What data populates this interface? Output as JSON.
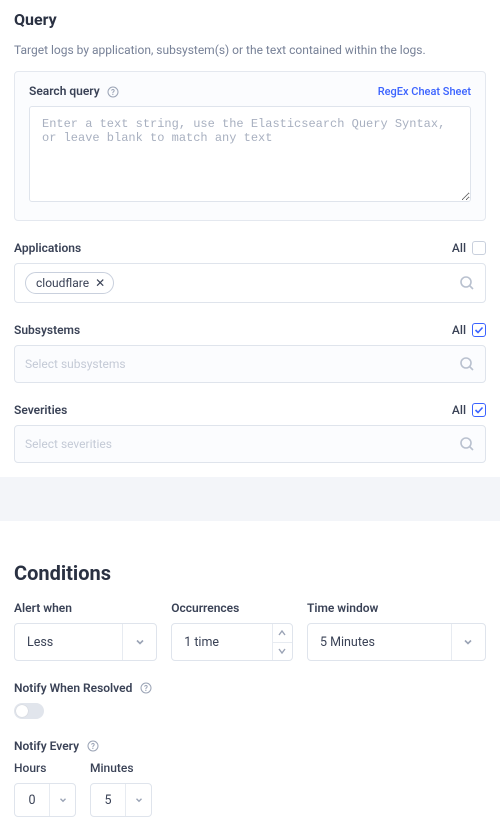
{
  "query": {
    "title": "Query",
    "subtitle": "Target logs by application, subsystem(s) or the text contained within the logs.",
    "search_label": "Search query",
    "cheat_link": "RegEx Cheat Sheet",
    "search_placeholder": "Enter a text string, use the Elasticsearch Query Syntax, or leave blank to match any text",
    "applications": {
      "label": "Applications",
      "all_label": "All",
      "all_checked": false,
      "chips": [
        "cloudflare"
      ]
    },
    "subsystems": {
      "label": "Subsystems",
      "all_label": "All",
      "all_checked": true,
      "placeholder": "Select subsystems"
    },
    "severities": {
      "label": "Severities",
      "all_label": "All",
      "all_checked": true,
      "placeholder": "Select severities"
    }
  },
  "conditions": {
    "title": "Conditions",
    "alert_when_label": "Alert when",
    "alert_when_value": "Less",
    "occurrences_label": "Occurrences",
    "occurrences_value": "1 time",
    "time_window_label": "Time window",
    "time_window_value": "5 Minutes",
    "notify_resolved_label": "Notify When Resolved",
    "notify_every_label": "Notify Every",
    "hours_label": "Hours",
    "hours_value": "0",
    "minutes_label": "Minutes",
    "minutes_value": "5"
  }
}
